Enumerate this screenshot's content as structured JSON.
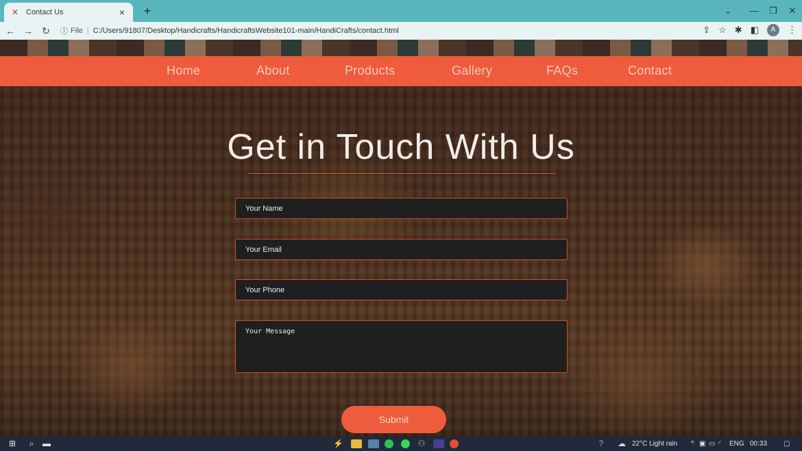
{
  "browser": {
    "tab_title": "Contact Us",
    "tab_close": "×",
    "new_tab": "+",
    "address_file": "File",
    "address_sep": "|",
    "address_url": "C:/Users/91807/Desktop/Handicrafts/HandicraftsWebsite101-main/HandiCrafts/contact.html",
    "profile_initial": "A"
  },
  "nav": {
    "items": [
      "Home",
      "About",
      "Products",
      "Gallery",
      "FAQs",
      "Contact"
    ]
  },
  "contact": {
    "heading": "Get in Touch With Us",
    "name_placeholder": "Your Name",
    "email_placeholder": "Your Email",
    "phone_placeholder": "Your Phone",
    "message_placeholder": "Your Message",
    "submit_label": "Submit"
  },
  "taskbar": {
    "weather": "22°C Light rain",
    "language": "ENG",
    "time": "00:33"
  },
  "colors": {
    "accent": "#ee5b3d",
    "tab_bar": "#5ab6bd",
    "field_bg": "#1f1f1f"
  }
}
